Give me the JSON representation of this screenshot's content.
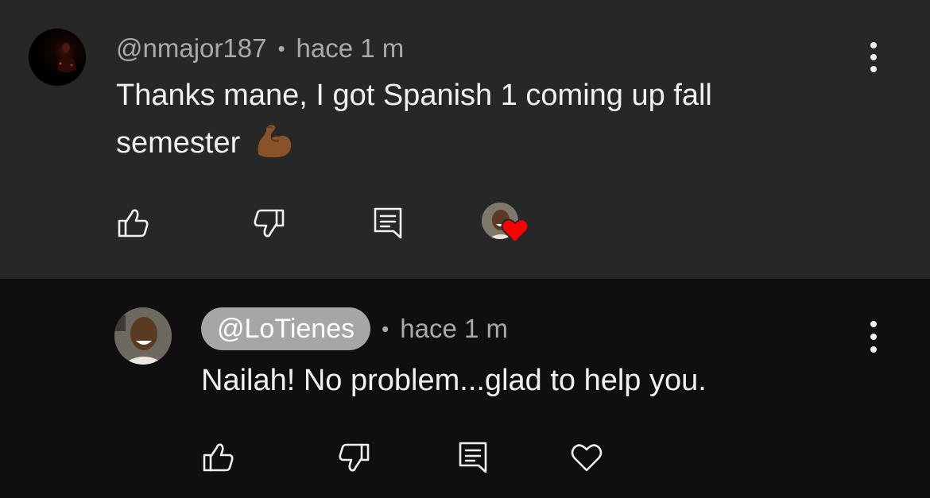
{
  "comments": [
    {
      "handle": "@nmajor187",
      "separator": "•",
      "time": "hace 1 m",
      "text": "Thanks mane, I got Spanish 1 coming up fall semester",
      "emoji": "flexed-biceps-emoji",
      "hearted_by_creator": true
    },
    {
      "handle": "@LoTienes",
      "separator": "•",
      "time": "hace 1 m",
      "text": "Nailah! No problem...glad to help you.",
      "hearted_by_creator": false
    }
  ],
  "icons": {
    "like": "thumbs-up-icon",
    "dislike": "thumbs-down-icon",
    "reply": "reply-icon",
    "heart": "heart-icon",
    "more": "more-vert-icon"
  },
  "colors": {
    "comment_bg_1": "#272727",
    "comment_bg_2": "#0f0f0f",
    "heart_red": "#ff0000",
    "handle_pill": "#a6a6a6"
  }
}
